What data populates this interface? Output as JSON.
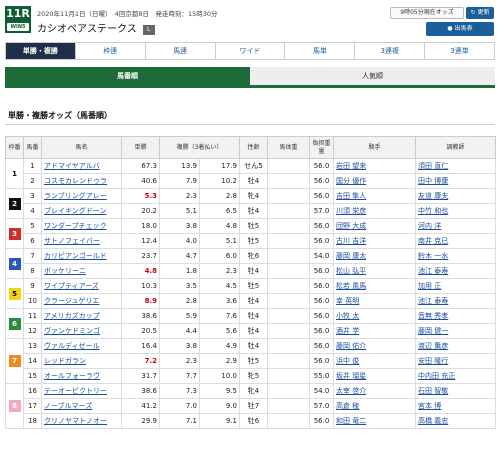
{
  "header": {
    "race_number": "11R",
    "badge_text": "WIN5",
    "meta": "2020年11月1日（日曜）　4回京都8日　発走時刻：15時30分",
    "race_name": "カシオペアステークス",
    "grade": "L",
    "odds_time": "9時05分現在オッズ",
    "refresh_label": "更新",
    "print_label": "出馬表"
  },
  "tabs": [
    "単勝・複勝",
    "枠連",
    "馬連",
    "ワイド",
    "馬単",
    "3連複",
    "3連単"
  ],
  "subtabs": [
    "馬番順",
    "人気順"
  ],
  "section_title": "単勝・複勝オッズ（馬番順）",
  "columns": [
    "枠番",
    "馬番",
    "馬名",
    "単勝",
    "複勝（3着払い）",
    "",
    "性齢",
    "馬体重",
    "負担重量",
    "騎手",
    "調教師"
  ],
  "colors": {
    "accent": "#1e6b3a",
    "nav": "#1e2f4a",
    "link": "#1a4fa0",
    "hot": "#d00000"
  },
  "rows": [
    {
      "waku": "1",
      "umaban": "1",
      "name": "アドマイヤアルバ",
      "win": "67.3",
      "plc_lo": "13.9",
      "plc_hi": "17.9",
      "sex_age": "せん5",
      "weight": "",
      "burden": "56.0",
      "jockey": "岩田 望来",
      "trainer": "須田 直仁",
      "hot": false
    },
    {
      "waku": "1",
      "umaban": "2",
      "name": "コスモカレンドゥラ",
      "win": "40.6",
      "plc_lo": "7.9",
      "plc_hi": "10.2",
      "sex_age": "牡4",
      "weight": "",
      "burden": "56.0",
      "jockey": "国分 優作",
      "trainer": "田中 博康",
      "hot": false
    },
    {
      "waku": "2",
      "umaban": "3",
      "name": "ランブリングアレー",
      "win": "5.3",
      "plc_lo": "2.3",
      "plc_hi": "2.8",
      "sex_age": "牝4",
      "weight": "",
      "burden": "56.0",
      "jockey": "吉田 隼人",
      "trainer": "友道 康夫",
      "hot": true
    },
    {
      "waku": "2",
      "umaban": "4",
      "name": "ブレイキングドーン",
      "win": "20.2",
      "plc_lo": "5.1",
      "plc_hi": "6.5",
      "sex_age": "牡4",
      "weight": "",
      "burden": "57.0",
      "jockey": "川須 栄彦",
      "trainer": "中竹 和也",
      "hot": false
    },
    {
      "waku": "3",
      "umaban": "5",
      "name": "ワンダープチェック",
      "win": "18.0",
      "plc_lo": "3.8",
      "plc_hi": "4.8",
      "sex_age": "牡5",
      "weight": "",
      "burden": "56.0",
      "jockey": "団野 大成",
      "trainer": "河内 洋",
      "hot": false
    },
    {
      "waku": "3",
      "umaban": "6",
      "name": "サトノフェイバー",
      "win": "12.4",
      "plc_lo": "4.0",
      "plc_hi": "5.1",
      "sex_age": "牡5",
      "weight": "",
      "burden": "56.0",
      "jockey": "古川 吉洋",
      "trainer": "南井 克巳",
      "hot": false
    },
    {
      "waku": "4",
      "umaban": "7",
      "name": "カリビアンゴールド",
      "win": "23.7",
      "plc_lo": "4.7",
      "plc_hi": "6.0",
      "sex_age": "牝6",
      "weight": "",
      "burden": "54.0",
      "jockey": "藤岡 康太",
      "trainer": "鈴木 一水",
      "hot": false
    },
    {
      "waku": "4",
      "umaban": "8",
      "name": "ボッケリーニ",
      "win": "4.8",
      "plc_lo": "1.8",
      "plc_hi": "2.3",
      "sex_age": "牡4",
      "weight": "",
      "burden": "56.0",
      "jockey": "松山 弘平",
      "trainer": "池江 泰寿",
      "hot": true
    },
    {
      "waku": "5",
      "umaban": "9",
      "name": "ワイプティアーズ",
      "win": "10.3",
      "plc_lo": "3.5",
      "plc_hi": "4.5",
      "sex_age": "牡5",
      "weight": "",
      "burden": "56.0",
      "jockey": "松若 風馬",
      "trainer": "加用 正",
      "hot": false
    },
    {
      "waku": "5",
      "umaban": "10",
      "name": "クラージュゲリエ",
      "win": "8.9",
      "plc_lo": "2.8",
      "plc_hi": "3.6",
      "sex_age": "牡4",
      "weight": "",
      "burden": "56.0",
      "jockey": "幸 英明",
      "trainer": "池江 泰寿",
      "hot": true
    },
    {
      "waku": "6",
      "umaban": "11",
      "name": "アメリカズカップ",
      "win": "38.6",
      "plc_lo": "5.9",
      "plc_hi": "7.6",
      "sex_age": "牡4",
      "weight": "",
      "burden": "56.0",
      "jockey": "小牧 太",
      "trainer": "音無 秀孝",
      "hot": false
    },
    {
      "waku": "6",
      "umaban": "12",
      "name": "ヴァンケドミンゴ",
      "win": "20.5",
      "plc_lo": "4.4",
      "plc_hi": "5.6",
      "sex_age": "牡4",
      "weight": "",
      "burden": "56.0",
      "jockey": "酒井 学",
      "trainer": "藤岡 健一",
      "hot": false
    },
    {
      "waku": "7",
      "umaban": "13",
      "name": "ヴァルディゼール",
      "win": "16.4",
      "plc_lo": "3.8",
      "plc_hi": "4.9",
      "sex_age": "牡4",
      "weight": "",
      "burden": "56.0",
      "jockey": "藤岡 佑介",
      "trainer": "渡辺 薫彦",
      "hot": false
    },
    {
      "waku": "7",
      "umaban": "14",
      "name": "レッドガラン",
      "win": "7.2",
      "plc_lo": "2.3",
      "plc_hi": "2.9",
      "sex_age": "牡5",
      "weight": "",
      "burden": "56.0",
      "jockey": "浜中 俊",
      "trainer": "安田 隆行",
      "hot": true
    },
    {
      "waku": "7",
      "umaban": "15",
      "name": "オールフォーラヴ",
      "win": "31.7",
      "plc_lo": "7.7",
      "plc_hi": "10.0",
      "sex_age": "牝5",
      "weight": "",
      "burden": "55.0",
      "jockey": "坂井 瑠星",
      "trainer": "中内田 充正",
      "hot": false
    },
    {
      "waku": "8",
      "umaban": "16",
      "name": "テーオービクトリー",
      "win": "38.6",
      "plc_lo": "7.3",
      "plc_hi": "9.5",
      "sex_age": "牝4",
      "weight": "",
      "burden": "54.0",
      "jockey": "太宰 啓介",
      "trainer": "石田 智敬",
      "hot": false
    },
    {
      "waku": "8",
      "umaban": "17",
      "name": "ノーブルマーズ",
      "win": "41.2",
      "plc_lo": "7.0",
      "plc_hi": "9.0",
      "sex_age": "牡7",
      "weight": "",
      "burden": "57.0",
      "jockey": "高倉 稜",
      "trainer": "宮本 博",
      "hot": false
    },
    {
      "waku": "8",
      "umaban": "18",
      "name": "クリノヤマトノオー",
      "win": "29.9",
      "plc_lo": "7.1",
      "plc_hi": "9.1",
      "sex_age": "牡6",
      "weight": "",
      "burden": "56.0",
      "jockey": "和田 竜二",
      "trainer": "高橋 義忠",
      "hot": false
    }
  ]
}
